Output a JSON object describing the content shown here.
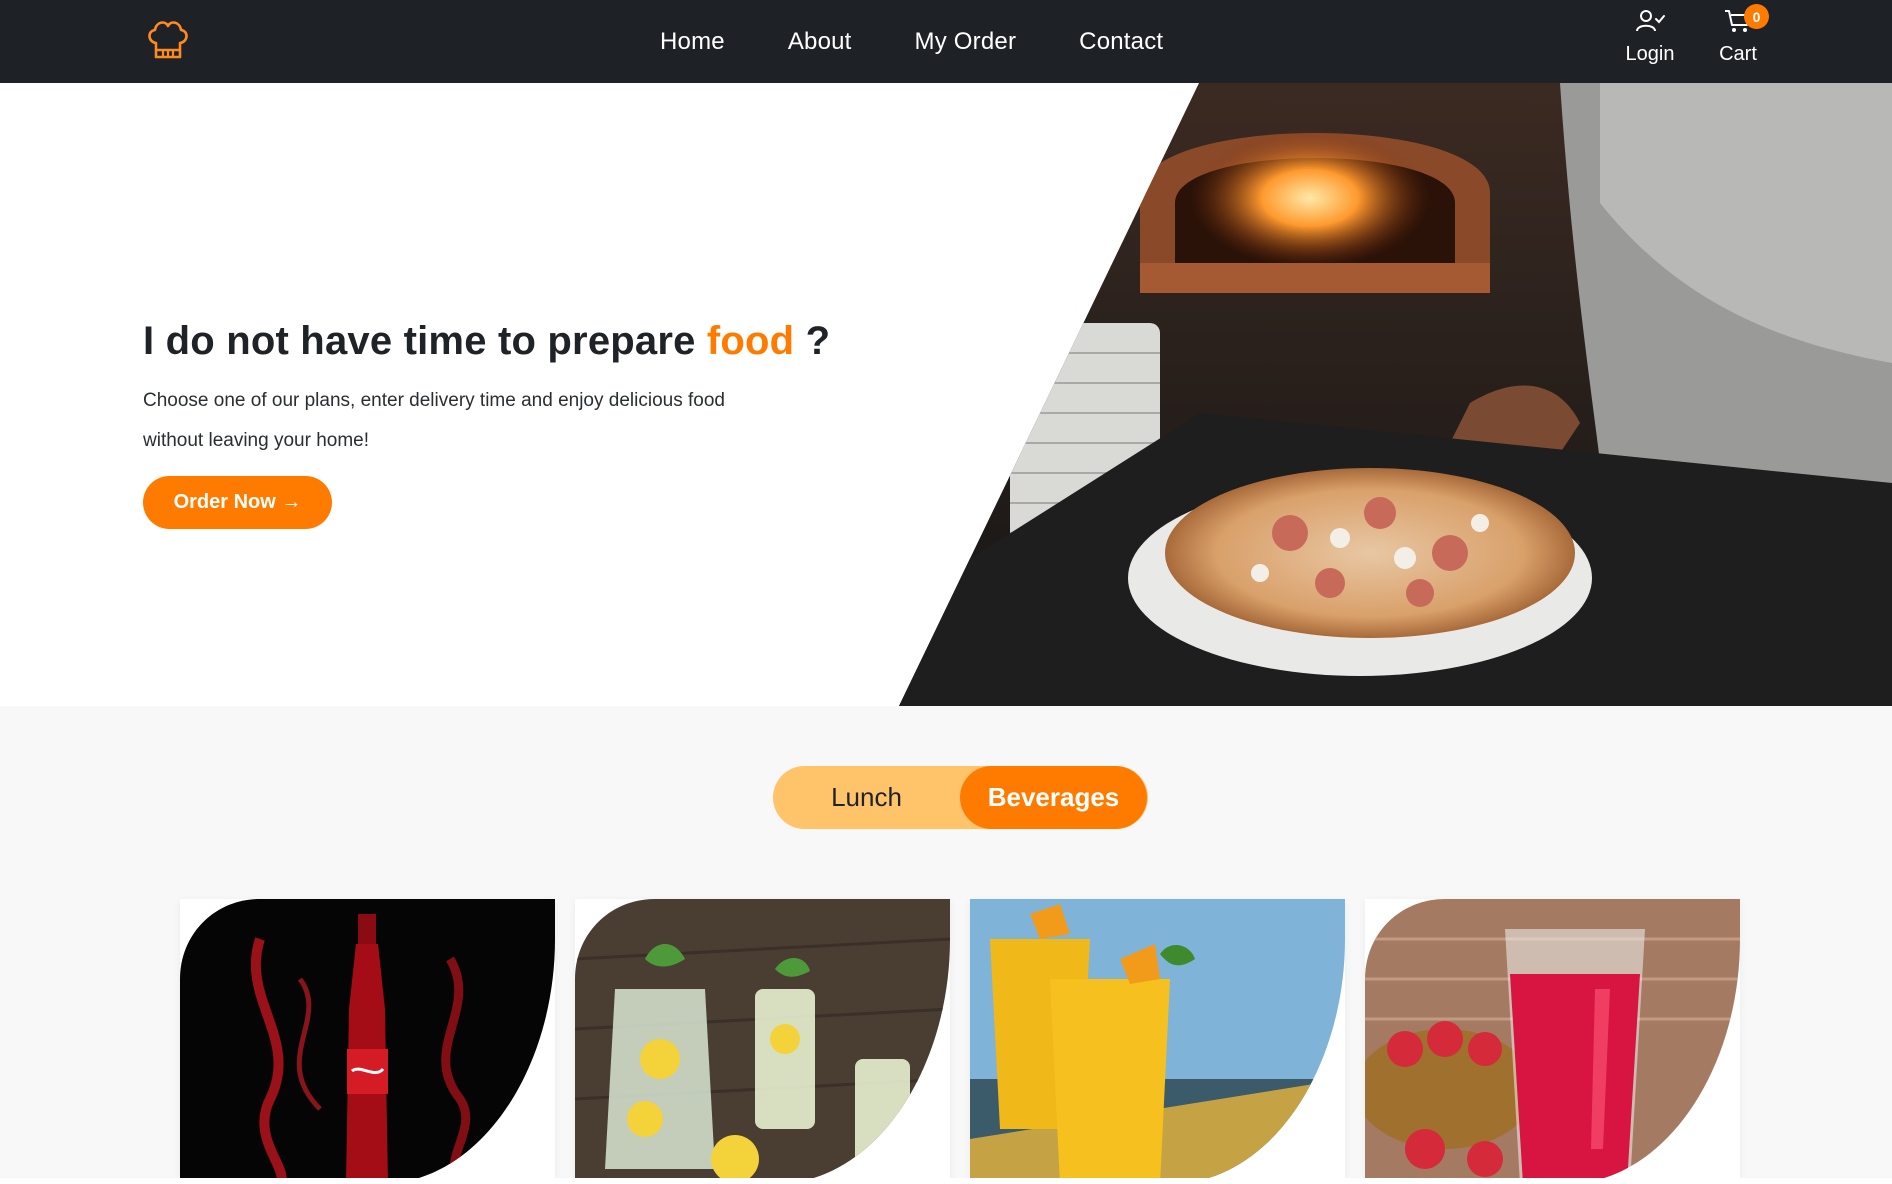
{
  "navbar": {
    "logo_icon": "chef-hat-icon",
    "links": [
      {
        "label": "Home"
      },
      {
        "label": "About"
      },
      {
        "label": "My Order"
      },
      {
        "label": "Contact"
      }
    ],
    "login": {
      "icon": "user-check-icon",
      "label": "Login"
    },
    "cart": {
      "icon": "cart-icon",
      "label": "Cart",
      "count": "0"
    }
  },
  "hero": {
    "title_prefix": "I do not have time to prepare ",
    "title_accent": "food",
    "title_suffix": " ?",
    "description": "Choose one of our plans, enter delivery time and enjoy delicious food without leaving your home!",
    "cta_label": "Order Now →",
    "image": "pizza-chef-oven-image"
  },
  "menu": {
    "tabs": [
      {
        "label": "Lunch",
        "active": false
      },
      {
        "label": "Beverages",
        "active": true
      }
    ],
    "items": [
      {
        "image": "cola-bottle-image"
      },
      {
        "image": "lemonade-pitcher-image"
      },
      {
        "image": "mango-juice-image"
      },
      {
        "image": "strawberry-juice-image"
      }
    ]
  },
  "colors": {
    "accent": "#ff7b00",
    "accent_light": "#ffc36a",
    "navbar_bg": "#1e2126",
    "section_bg": "#f8f8f8"
  }
}
